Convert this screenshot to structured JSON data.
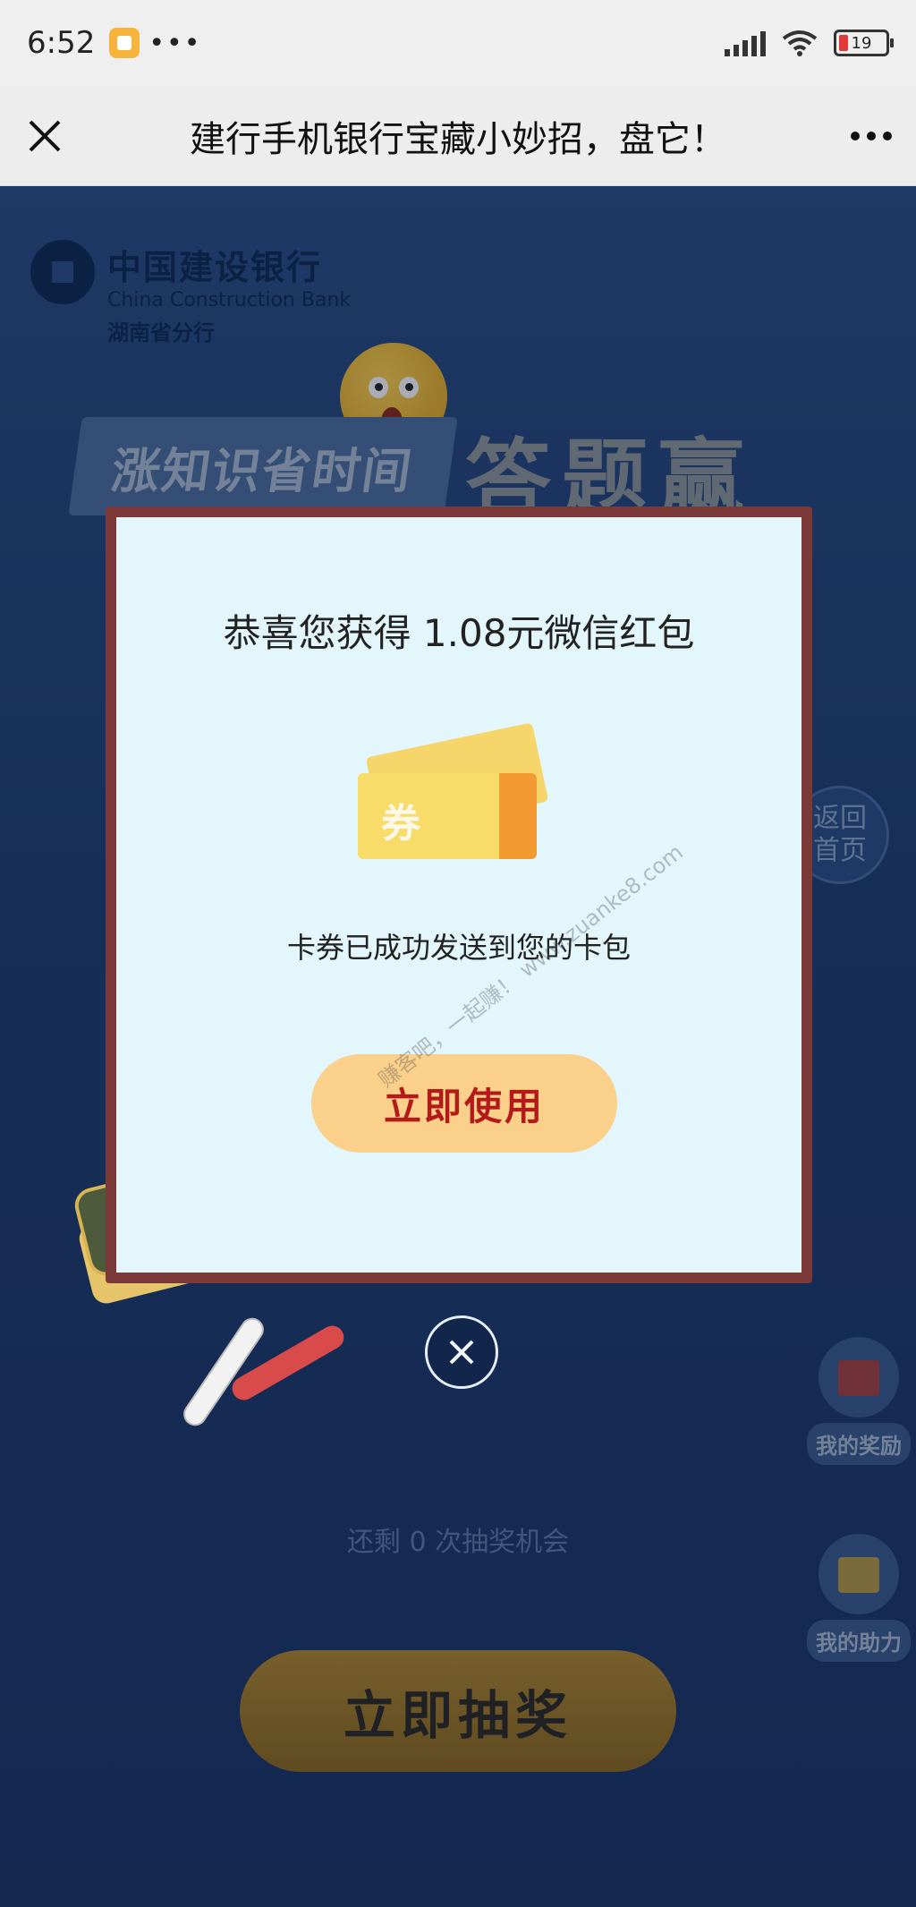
{
  "status_bar": {
    "time": "6:52",
    "battery": "19"
  },
  "nav": {
    "title": "建行手机银行宝藏小妙招，盘它！"
  },
  "logo": {
    "cn": "中国建设银行",
    "en": "China Construction Bank",
    "branch": "湖南省分行"
  },
  "banner": {
    "left": "涨知识省时间",
    "right": "答题赢"
  },
  "side": {
    "back_home": "返回首页",
    "my_reward": "我的奖励",
    "my_assist": "我的助力"
  },
  "page": {
    "chances": "还剩 0 次抽奖机会",
    "draw_button": "立即抽奖"
  },
  "modal": {
    "message": "恭喜您获得 1.08元微信红包",
    "coupon_label": "券",
    "sub": "卡券已成功发送到您的卡包",
    "use_button": "立即使用"
  },
  "watermark": "赚客吧，一起赚！ www.zuanke8.com"
}
